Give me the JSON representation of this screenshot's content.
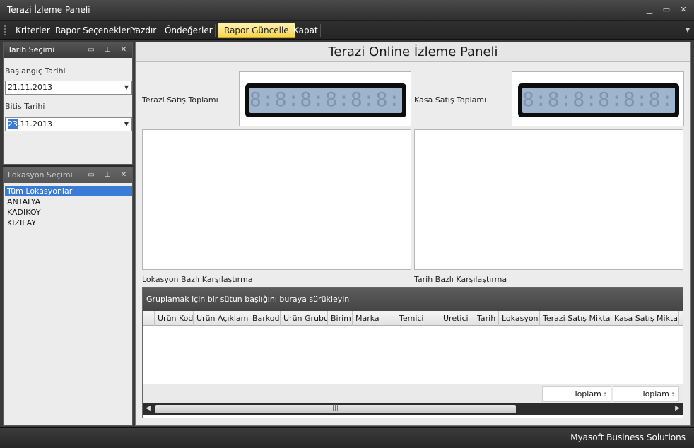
{
  "window": {
    "title": "Terazi İzleme Paneli"
  },
  "toolbar": {
    "items": [
      "Kriterler",
      "Rapor Seçenekleri",
      "Yazdır",
      "Öndeğerler",
      "Rapor Güncelle",
      "Kapat"
    ]
  },
  "date_panel": {
    "title": "Tarih Seçimi",
    "start_label": "Başlangıç Tarihi",
    "start_value": "21.11.2013",
    "end_label": "Bitiş Tarihi",
    "end_value_day": "23",
    "end_value_rest": ".11.2013"
  },
  "location_panel": {
    "title": "Lokasyon Seçimi",
    "items": [
      "Tüm Lokasyonlar",
      "ANTALYA",
      "KADIKÖY",
      "KIZILAY"
    ],
    "selected_index": 0
  },
  "main": {
    "title": "Terazi Online İzleme Paneli",
    "scale_total_label": "Terazi Satış Toplamı",
    "cashier_total_label": "Kasa Satış Toplamı",
    "lcd_display": "8:8:8:8:8:8:8:8:8",
    "location_compare_label": "Lokasyon Bazlı Karşılaştırma",
    "date_compare_label": "Tarih Bazlı Karşılaştırma"
  },
  "grid": {
    "group_hint": "Gruplamak için bir sütun başlığını buraya sürükleyin",
    "columns": [
      "Ürün Kod",
      "Ürün Açıklama",
      "Barkod",
      "Ürün Grubu",
      "Birim",
      "Marka",
      "Temici",
      "Üretici",
      "Tarih",
      "Lokasyon",
      "Terazi Satış Miktarı",
      "Kasa Satış Miktarı"
    ],
    "summary": [
      "Toplam :",
      "Toplam :"
    ]
  },
  "status": {
    "text": "Myasoft Business Solutions"
  }
}
